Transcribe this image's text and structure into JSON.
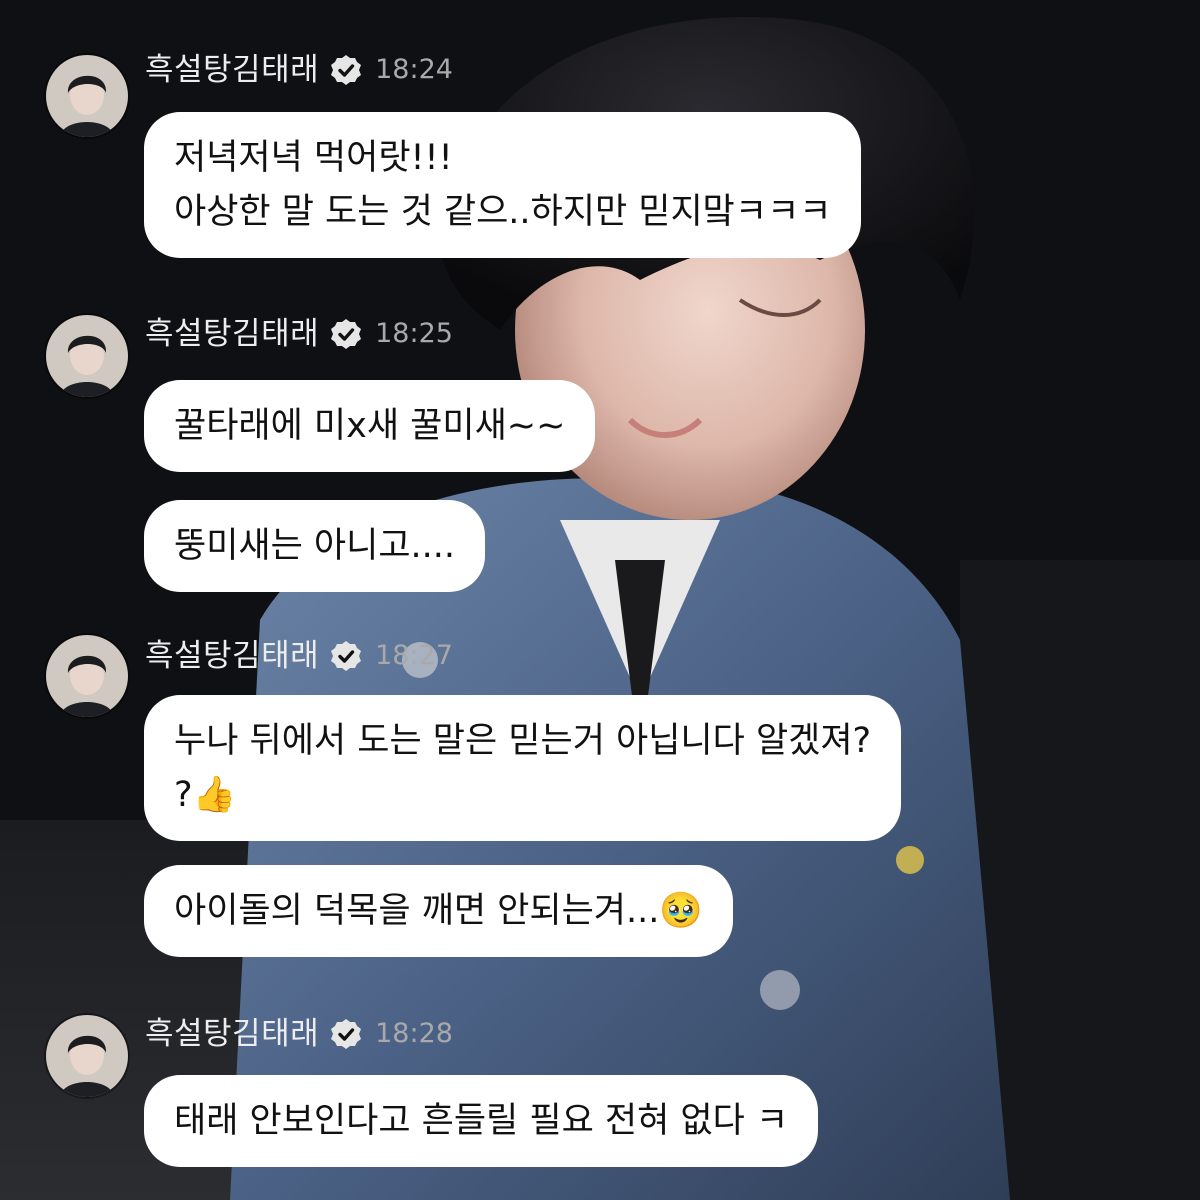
{
  "colors": {
    "bubble_background": "#ffffff",
    "bubble_text": "#111111",
    "sender_name": "#ededed",
    "timestamp": "#a9a9a9",
    "verified_badge": "#e6e6e6"
  },
  "messages": [
    {
      "sender": "흑설탕김태래",
      "verified": true,
      "time": "18:24",
      "bubbles": [
        {
          "lines": [
            "저녁저녁 먹어랏!!!",
            "아상한 말 도는 것 같으..하지만 믿지맠ㅋㅋㅋ"
          ]
        }
      ]
    },
    {
      "sender": "흑설탕김태래",
      "verified": true,
      "time": "18:25",
      "bubbles": [
        {
          "lines": [
            "꿀타래에 미x새 꿀미새~~"
          ]
        },
        {
          "lines": [
            "뚱미새는 아니고...."
          ]
        }
      ]
    },
    {
      "sender": "흑설탕김태래",
      "verified": true,
      "time": "18:27",
      "bubbles": [
        {
          "lines": [
            "누나 뒤에서 도는 말은 믿는거 아닙니다 알겠져?",
            "?👍"
          ]
        },
        {
          "lines": [
            "아이돌의 덕목을 깨면 안되는겨...🥹"
          ]
        }
      ]
    },
    {
      "sender": "흑설탕김태래",
      "verified": true,
      "time": "18:28",
      "bubbles": [
        {
          "lines": [
            "태래 안보인다고 흔들릴 필요 전혀 없다 ㅋ"
          ]
        }
      ]
    }
  ]
}
